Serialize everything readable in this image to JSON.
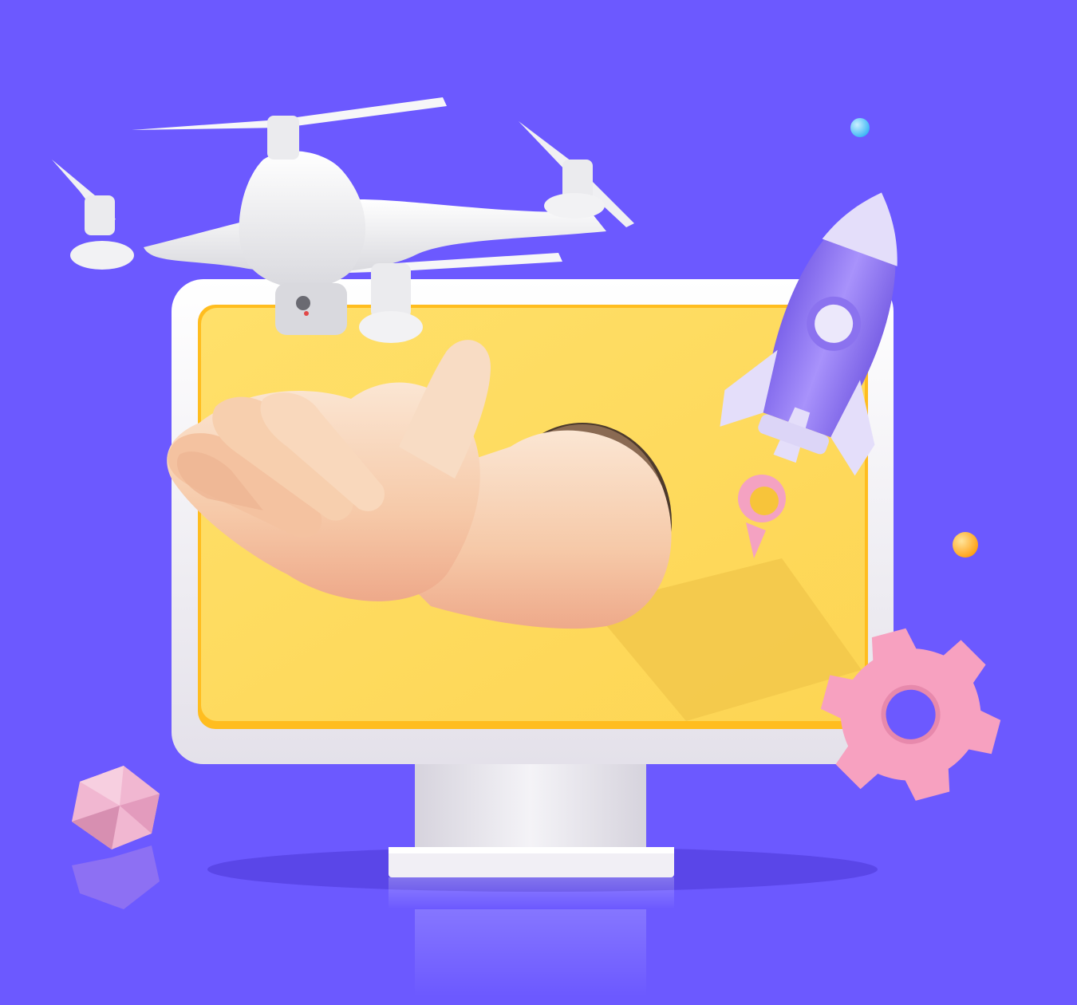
{
  "scene": {
    "description_free": true,
    "colors": {
      "background": "#6c59ff",
      "monitor_frame": "#f3f1f6",
      "monitor_screen": "#fddc5a",
      "screen_border": "#ffbd1f",
      "rocket_body": "#9a84f4",
      "rocket_fins": "#e8e3f7",
      "gear": "#f7a1c0",
      "gem": "#f1b7d1",
      "hand_skin": "#f6cfb1",
      "drone": "#f4f4f6",
      "orb_blue": "#56c7ff",
      "orb_orange": "#ffb72a"
    },
    "icons": [
      "drone-icon",
      "monitor-icon",
      "hand-icon",
      "rocket-icon",
      "gear-icon",
      "gem-icon",
      "orb-icon"
    ]
  }
}
